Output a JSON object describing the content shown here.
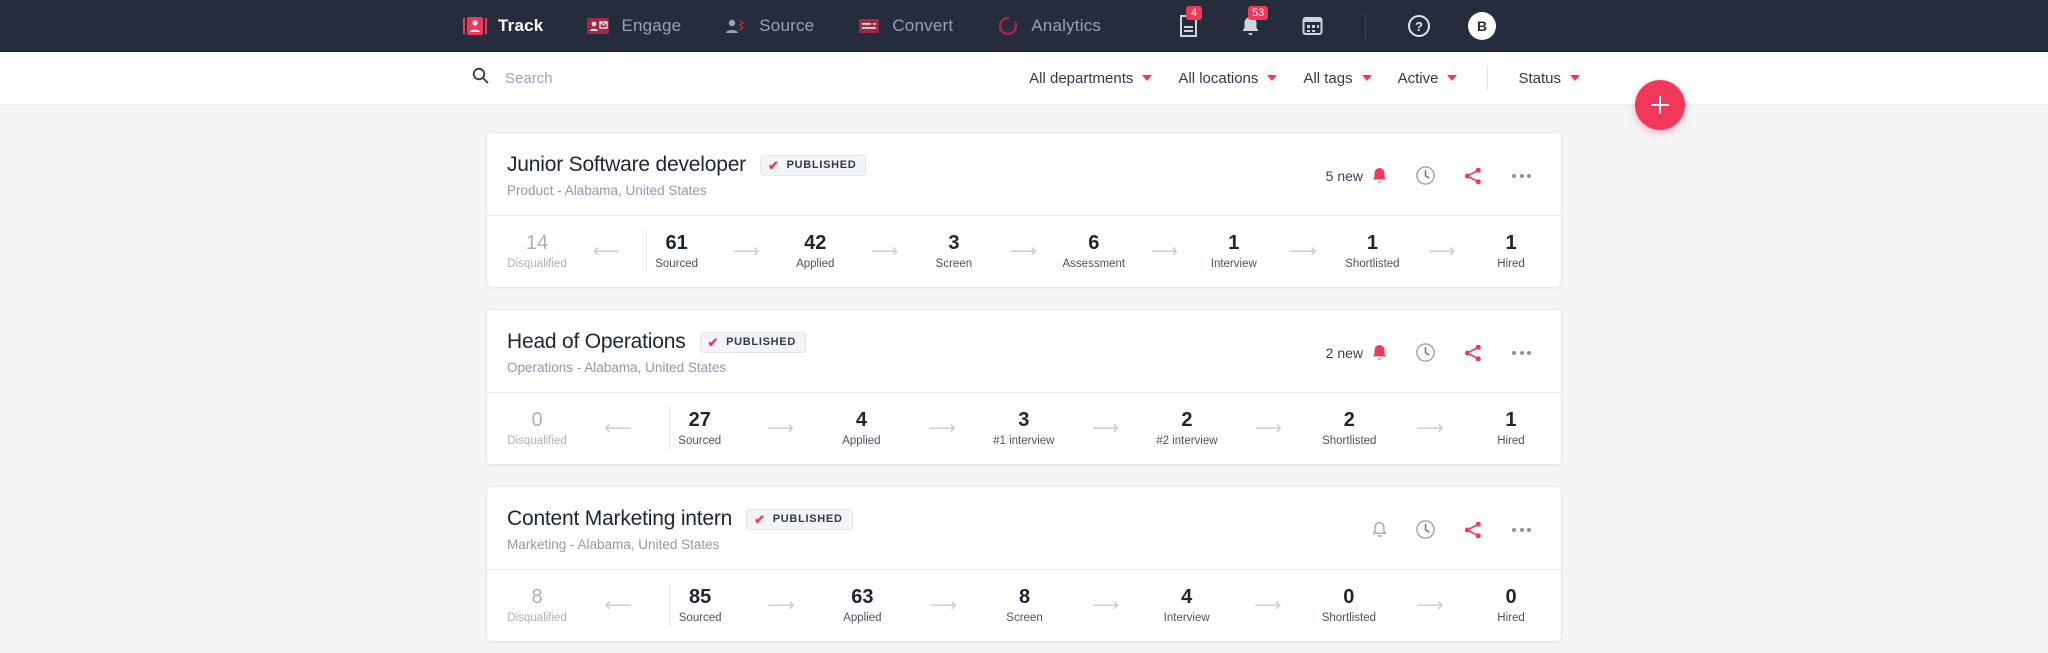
{
  "topnav": {
    "items": [
      {
        "label": "Track",
        "icon": "track-icon",
        "active": true
      },
      {
        "label": "Engage",
        "icon": "engage-icon",
        "active": false
      },
      {
        "label": "Source",
        "icon": "source-icon",
        "active": false
      },
      {
        "label": "Convert",
        "icon": "convert-icon",
        "active": false
      },
      {
        "label": "Analytics",
        "icon": "analytics-icon",
        "active": false
      }
    ],
    "right": {
      "tasks_badge": "4",
      "notifications_badge": "53",
      "calendar_icon": "calendar-icon",
      "help_icon": "help-icon",
      "avatar_initial": "B"
    }
  },
  "filterbar": {
    "search_placeholder": "Search",
    "search_value": "",
    "filters": [
      {
        "label": "All departments"
      },
      {
        "label": "All locations"
      },
      {
        "label": "All tags"
      },
      {
        "label": "Active"
      },
      {
        "label": "Status"
      }
    ],
    "add_button_label": "+"
  },
  "colors": {
    "accent": "#f2385a",
    "nav_bg": "#252d3d",
    "page_bg": "#f4f5f7",
    "muted": "#9099a8"
  },
  "jobs": [
    {
      "title": "Junior Software developer",
      "status": "PUBLISHED",
      "subtitle": "Product - Alabama, United States",
      "new_label": "5 new",
      "has_new": true,
      "stages": [
        {
          "value": "14",
          "label": "Disqualified",
          "muted": true
        },
        {
          "value": "61",
          "label": "Sourced"
        },
        {
          "value": "42",
          "label": "Applied"
        },
        {
          "value": "3",
          "label": "Screen"
        },
        {
          "value": "6",
          "label": "Assessment"
        },
        {
          "value": "1",
          "label": "Interview"
        },
        {
          "value": "1",
          "label": "Shortlisted"
        },
        {
          "value": "1",
          "label": "Hired"
        }
      ]
    },
    {
      "title": "Head of Operations",
      "status": "PUBLISHED",
      "subtitle": "Operations - Alabama, United States",
      "new_label": "2 new",
      "has_new": true,
      "stages": [
        {
          "value": "0",
          "label": "Disqualified",
          "muted": true
        },
        {
          "value": "27",
          "label": "Sourced"
        },
        {
          "value": "4",
          "label": "Applied"
        },
        {
          "value": "3",
          "label": "#1 interview"
        },
        {
          "value": "2",
          "label": "#2 interview"
        },
        {
          "value": "2",
          "label": "Shortlisted"
        },
        {
          "value": "1",
          "label": "Hired"
        }
      ]
    },
    {
      "title": "Content Marketing intern",
      "status": "PUBLISHED",
      "subtitle": "Marketing - Alabama, United States",
      "new_label": "",
      "has_new": false,
      "stages": [
        {
          "value": "8",
          "label": "Disqualified",
          "muted": true
        },
        {
          "value": "85",
          "label": "Sourced"
        },
        {
          "value": "63",
          "label": "Applied"
        },
        {
          "value": "8",
          "label": "Screen"
        },
        {
          "value": "4",
          "label": "Interview"
        },
        {
          "value": "0",
          "label": "Shortlisted"
        },
        {
          "value": "0",
          "label": "Hired"
        }
      ]
    }
  ]
}
